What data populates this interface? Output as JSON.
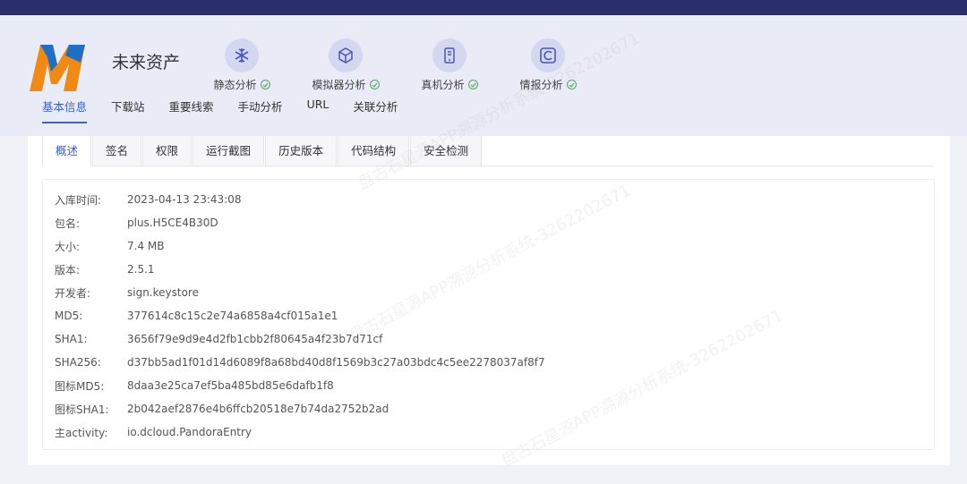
{
  "app": {
    "name": "未来资产"
  },
  "steps": [
    {
      "label": "静态分析",
      "icon": "snowflake-icon"
    },
    {
      "label": "模拟器分析",
      "icon": "cube-icon"
    },
    {
      "label": "真机分析",
      "icon": "phone-icon"
    },
    {
      "label": "情报分析",
      "icon": "letter-c-icon"
    }
  ],
  "nav": [
    "基本信息",
    "下载站",
    "重要线索",
    "手动分析",
    "URL",
    "关联分析"
  ],
  "subtabs": [
    "概述",
    "签名",
    "权限",
    "运行截图",
    "历史版本",
    "代码结构",
    "安全检测"
  ],
  "info": [
    {
      "key": "入库时间:",
      "value": "2023-04-13 23:43:08"
    },
    {
      "key": "包名:",
      "value": "plus.H5CE4B30D"
    },
    {
      "key": "大小:",
      "value": "7.4 MB"
    },
    {
      "key": "版本:",
      "value": "2.5.1"
    },
    {
      "key": "开发者:",
      "value": "sign.keystore"
    },
    {
      "key": "MD5:",
      "value": "377614c8c15c2e74a6858a4cf015a1e1"
    },
    {
      "key": "SHA1:",
      "value": "3656f79e9d9e4d2fb1cbb2f80645a4f23b7d71cf"
    },
    {
      "key": "SHA256:",
      "value": "d37bb5ad1f01d14d6089f8a68bd40d8f1569b3c27a03bdc4c5ee2278037af8f7"
    },
    {
      "key": "图标MD5:",
      "value": "8daa3e25ca7ef5ba485bd85e6dafb1f8"
    },
    {
      "key": "图标SHA1:",
      "value": "2b042aef2876e4b6ffcb20518e7b74da2752b2ad"
    },
    {
      "key": "主activity:",
      "value": "io.dcloud.PandoraEntry"
    }
  ],
  "watermark": "盘古石星源APP溯源分析系统-3262202671",
  "colors": {
    "accent": "#3c5fd6",
    "topbar": "#2b2f6b",
    "check": "#4caf50"
  }
}
